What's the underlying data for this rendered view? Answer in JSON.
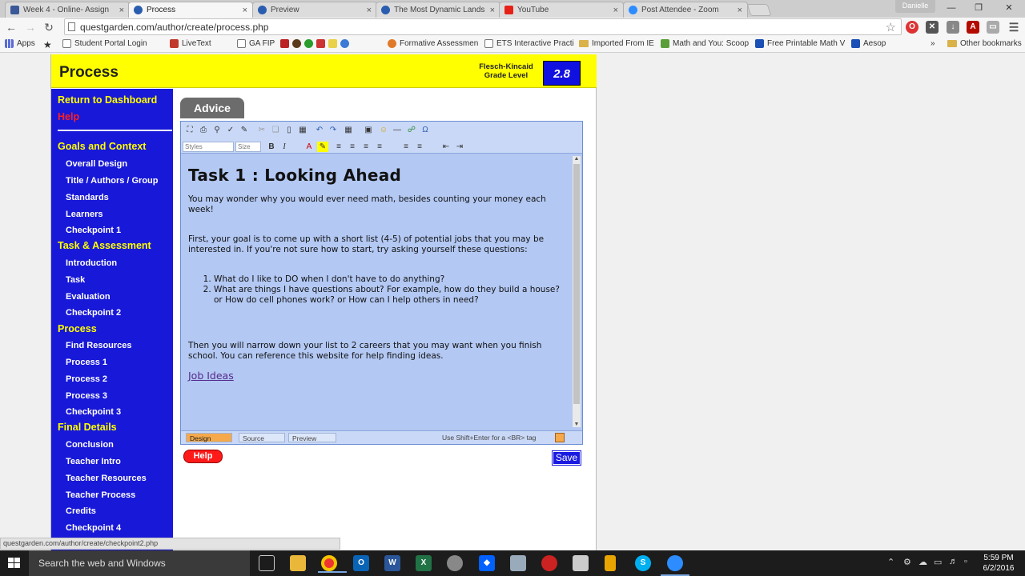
{
  "browser": {
    "tabs": [
      {
        "title": "Week 4 - Online- Assign",
        "color": "#3b5998"
      },
      {
        "title": "Process",
        "color": "#2a5db0"
      },
      {
        "title": "Preview",
        "color": "#2a5db0"
      },
      {
        "title": "The Most Dynamic Lands",
        "color": "#2a5db0"
      },
      {
        "title": "YouTube",
        "color": "#e62117"
      },
      {
        "title": "Post Attendee - Zoom",
        "color": "#2d8cff"
      }
    ],
    "close_glyph": "×",
    "user": "Danielle",
    "url": "questgarden.com/author/create/process.php",
    "bookmarks": [
      "Apps",
      "Student Portal Login",
      "LiveText",
      "GA FIP",
      "Formative Assessmen",
      "ETS Interactive Practi",
      "Imported From IE",
      "Math and You: Scoop",
      "Free Printable Math V",
      "Aesop",
      "Other bookmarks"
    ],
    "overflow": "»"
  },
  "header": {
    "title": "Process",
    "fk_label": "Flesch-Kincaid Grade Level",
    "fk_value": "2.8"
  },
  "sidebar": {
    "return": "Return to Dashboard",
    "help": "Help",
    "goals": "Goals and Context",
    "overall_design": "Overall Design",
    "title_authors": "Title / Authors / Group",
    "standards": "Standards",
    "learners": "Learners",
    "checkpoint1": "Checkpoint 1",
    "task_assessment": "Task & Assessment",
    "introduction": "Introduction",
    "task": "Task",
    "evaluation": "Evaluation",
    "checkpoint2": "Checkpoint 2",
    "process": "Process",
    "find_resources": "Find Resources",
    "process1": "Process 1",
    "process2": "Process 2",
    "process3": "Process 3",
    "checkpoint3": "Checkpoint 3",
    "final_details": "Final Details",
    "conclusion": "Conclusion",
    "teacher_intro": "Teacher Intro",
    "teacher_resources": "Teacher Resources",
    "teacher_process": "Teacher Process",
    "credits": "Credits",
    "checkpoint4": "Checkpoint 4"
  },
  "editor": {
    "tab": "Advice",
    "styles_placeholder": "Styles",
    "size_placeholder": "Size",
    "heading": "Task 1 : Looking Ahead",
    "para1": "You may wonder why you would ever need math, besides counting your money each week!",
    "para2": "First, your goal is to come up with a short list (4-5) of potential jobs that you may be interested in.  If you're not sure how to start, try asking yourself these questions:",
    "list": [
      "What do I like to DO when I don't have to do anything?",
      "What are things I have questions about?  For example, how do they build a house?  or How do cell phones work?  or How can I help others in need?"
    ],
    "para3": "Then you will narrow down your list to 2 careers that you may want when you finish school. You can reference this website for help finding ideas.",
    "link": "Job Ideas",
    "modes": [
      "Design",
      "Source",
      "Preview"
    ],
    "hint": "Use Shift+Enter for a <BR> tag"
  },
  "buttons": {
    "help": "Help",
    "save": "Save"
  },
  "status": "questgarden.com/author/create/checkpoint2.php",
  "taskbar": {
    "search": "Search the web and Windows",
    "time": "5:59 PM",
    "date": "6/2/2016"
  }
}
